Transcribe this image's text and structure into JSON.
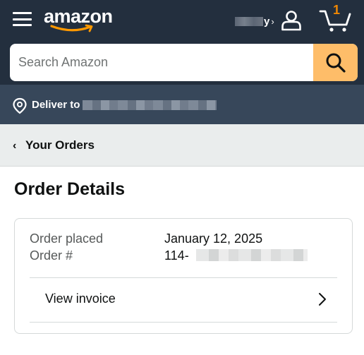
{
  "header": {
    "logo_text": "amazon",
    "account_name": "y",
    "account_chevron": "›",
    "cart_count": "1",
    "icons": [
      "hamburger-menu-icon",
      "user-icon",
      "cart-icon",
      "search-icon"
    ],
    "colors": {
      "nav": "#232f3e",
      "accent": "#febd69",
      "cart_count": "#f08804"
    }
  },
  "search": {
    "placeholder": "Search Amazon"
  },
  "deliver": {
    "label": "Deliver to",
    "icon": "location-pin-icon",
    "background": "#37475a"
  },
  "orders_nav": {
    "back_chevron": "‹",
    "label": "Your Orders"
  },
  "page": {
    "title": "Order Details"
  },
  "order": {
    "placed_label": "Order placed",
    "placed_value": "January 12, 2025",
    "number_label": "Order #",
    "number_value": "114-",
    "invoice_label": "View invoice"
  }
}
